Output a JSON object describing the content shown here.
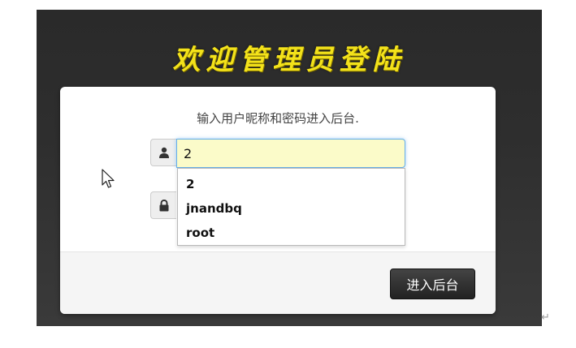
{
  "banner": {
    "title": "欢迎管理员登陆"
  },
  "login": {
    "hint": "输入用户昵称和密码进入后台.",
    "username_value": "2",
    "submit_label": "进入后台",
    "autocomplete_options": [
      "2",
      "jnandbq",
      "root"
    ]
  },
  "icons": {
    "username": "user-icon",
    "password": "lock-icon",
    "pointer": "mouse-cursor-icon",
    "return_mark": "paragraph-return-icon"
  },
  "glyphs": {
    "return_mark": "↵"
  },
  "colors": {
    "banner_text": "#f3e21a",
    "frame_bg": "#2e2e2e",
    "panel_bg": "#ffffff",
    "input_focus_bg": "#fbfbc9",
    "focus_border": "#66afe9",
    "button_bg": "#333333"
  }
}
